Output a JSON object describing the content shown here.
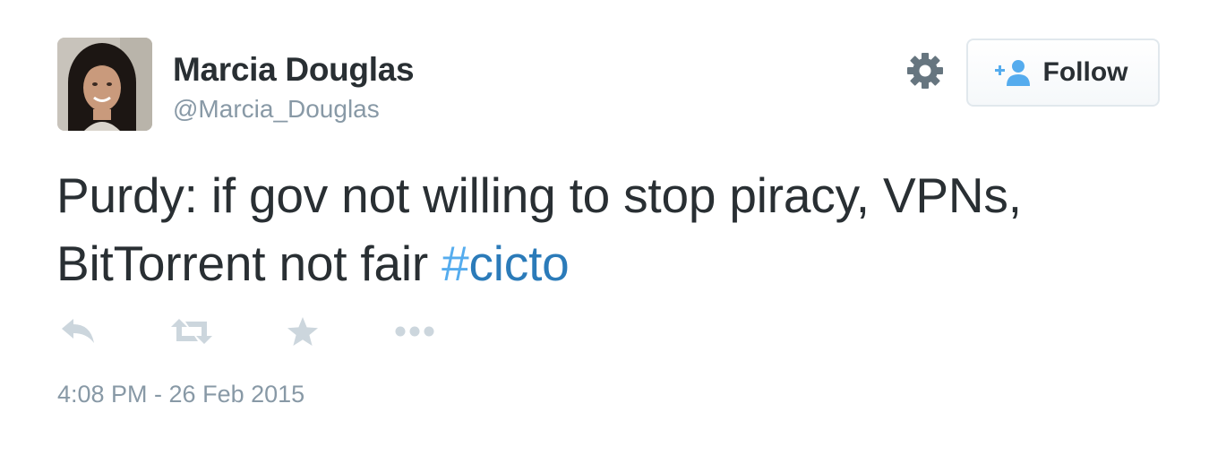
{
  "user": {
    "name": "Marcia Douglas",
    "handle": "@Marcia_Douglas"
  },
  "header": {
    "follow_label": "Follow",
    "settings_icon": "gear-icon",
    "follow_icon": "add-user-icon"
  },
  "tweet": {
    "text": "Purdy: if gov not willing to stop piracy, VPNs, BitTorrent not fair ",
    "hashtag_symbol": "#",
    "hashtag_text": "cicto",
    "timestamp": "4:08 PM - 26 Feb 2015"
  },
  "actions": [
    {
      "icon": "reply-icon"
    },
    {
      "icon": "retweet-icon"
    },
    {
      "icon": "favorite-star-icon"
    },
    {
      "icon": "more-icon"
    }
  ],
  "colors": {
    "text": "#292f33",
    "muted": "#8899a6",
    "hashtag": "#2b7bb9",
    "hashtag_symbol": "#55acee",
    "action_icon": "#ccd6dd",
    "follow_icon": "#55acee",
    "gear": "#66757f"
  }
}
